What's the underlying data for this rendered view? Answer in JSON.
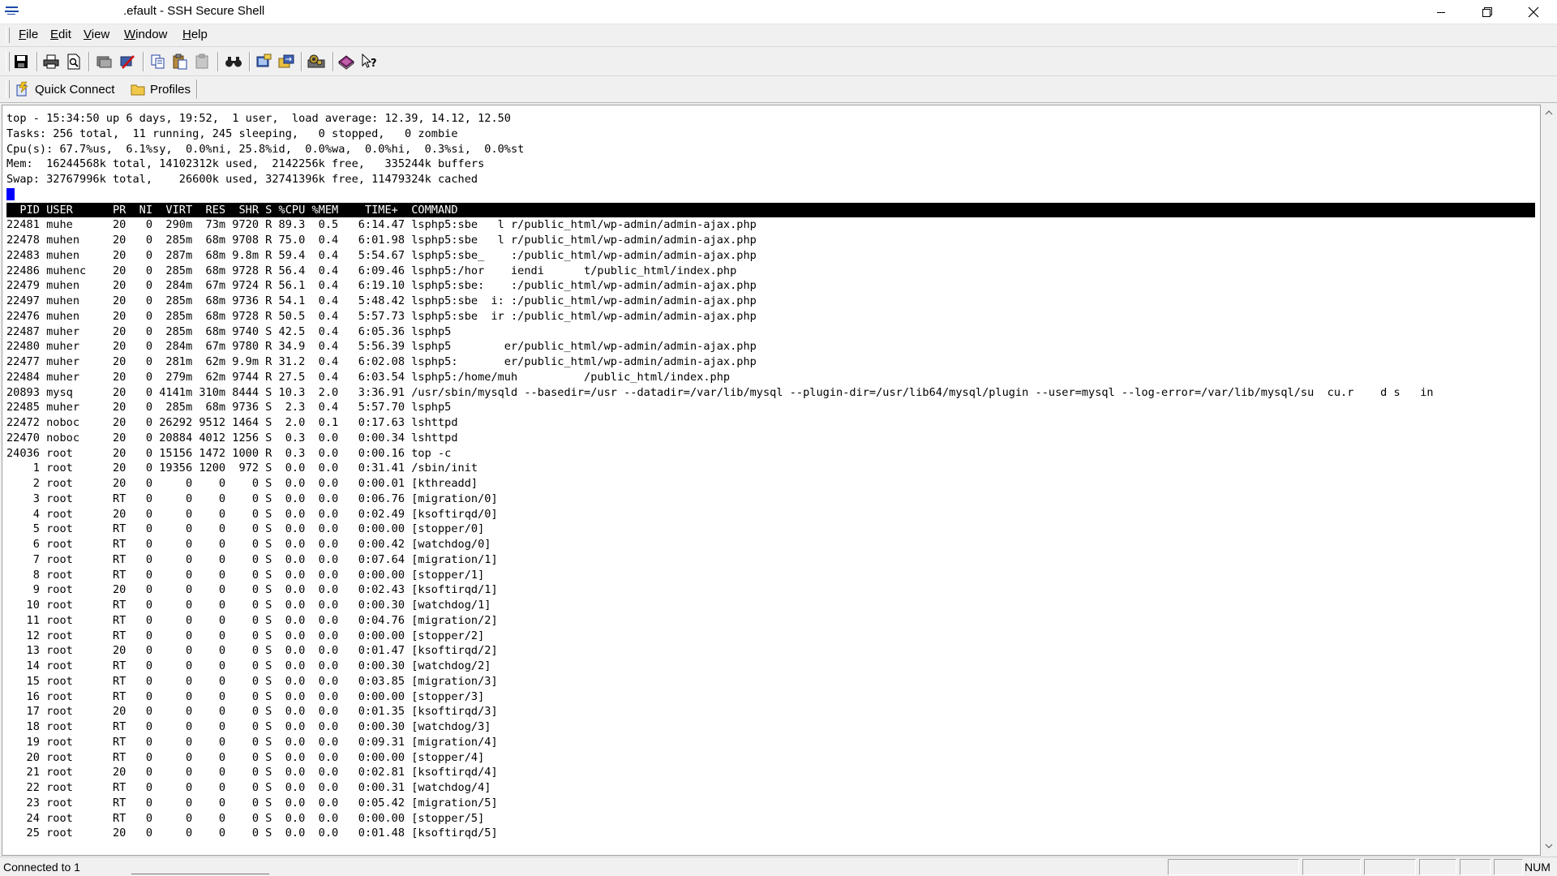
{
  "window": {
    "title": ".efault - SSH Secure Shell",
    "controls": [
      "minimize",
      "restore",
      "close"
    ]
  },
  "menu": {
    "items": [
      {
        "mnemonic": "F",
        "rest": "ile"
      },
      {
        "mnemonic": "E",
        "rest": "dit"
      },
      {
        "mnemonic": "V",
        "rest": "iew"
      },
      {
        "mnemonic": "W",
        "rest": "indow"
      },
      {
        "mnemonic": "H",
        "rest": "elp"
      }
    ]
  },
  "toolbar": {
    "icons": [
      "save-icon",
      "print-icon",
      "print-preview-icon",
      "new-file-transfer-icon",
      "disconnect-icon",
      "copy-icon",
      "paste-icon",
      "paste-disabled-icon",
      "find-icon",
      "new-terminal-icon",
      "file-transfer-icon",
      "settings-icon",
      "help-book-icon",
      "whats-this-icon"
    ]
  },
  "quickbar": {
    "quick_connect": "Quick Connect",
    "profiles": "Profiles"
  },
  "terminal": {
    "summary": [
      "top - 15:34:50 up 6 days, 19:52,  1 user,  load average: 12.39, 14.12, 12.50",
      "Tasks: 256 total,  11 running, 245 sleeping,   0 stopped,   0 zombie",
      "Cpu(s): 67.7%us,  6.1%sy,  0.0%ni, 25.8%id,  0.0%wa,  0.0%hi,  0.3%si,  0.0%st",
      "Mem:  16244568k total, 14102312k used,  2142256k free,   335244k buffers",
      "Swap: 32767996k total,    26600k used, 32741396k free, 11479324k cached"
    ],
    "header": "  PID USER      PR  NI  VIRT  RES  SHR S %CPU %MEM    TIME+  COMMAND",
    "processes": [
      "22481 muhe      20   0  290m  73m 9720 R 89.3  0.5   6:14.47 lsphp5:sbe   l r/public_html/wp-admin/admin-ajax.php",
      "22478 muhen     20   0  285m  68m 9708 R 75.0  0.4   6:01.98 lsphp5:sbe   l r/public_html/wp-admin/admin-ajax.php",
      "22483 muhen     20   0  287m  68m 9.8m R 59.4  0.4   5:54.67 lsphp5:sbe_    :/public_html/wp-admin/admin-ajax.php",
      "22486 muhenc    20   0  285m  68m 9728 R 56.4  0.4   6:09.46 lsphp5:/hor    iendi      t/public_html/index.php",
      "22479 muhen     20   0  284m  67m 9724 R 56.1  0.4   6:19.10 lsphp5:sbe:    :/public_html/wp-admin/admin-ajax.php",
      "22497 muhen     20   0  285m  68m 9736 R 54.1  0.4   5:48.42 lsphp5:sbe  i: :/public_html/wp-admin/admin-ajax.php",
      "22476 muhen     20   0  285m  68m 9728 R 50.5  0.4   5:57.73 lsphp5:sbe  ir :/public_html/wp-admin/admin-ajax.php",
      "22487 muher     20   0  285m  68m 9740 S 42.5  0.4   6:05.36 lsphp5",
      "22480 muher     20   0  284m  67m 9780 R 34.9  0.4   5:56.39 lsphp5        er/public_html/wp-admin/admin-ajax.php",
      "22477 muher     20   0  281m  62m 9.9m R 31.2  0.4   6:02.08 lsphp5:       er/public_html/wp-admin/admin-ajax.php",
      "22484 muher     20   0  279m  62m 9744 R 27.5  0.4   6:03.54 lsphp5:/home/muh          /public_html/index.php",
      "20893 mysq      20   0 4141m 310m 8444 S 10.3  2.0   3:36.91 /usr/sbin/mysqld --basedir=/usr --datadir=/var/lib/mysql --plugin-dir=/usr/lib64/mysql/plugin --user=mysql --log-error=/var/lib/mysql/su  cu.r    d s   in",
      "22485 muher     20   0  285m  68m 9736 S  2.3  0.4   5:57.70 lsphp5",
      "22472 noboc     20   0 26292 9512 1464 S  2.0  0.1   0:17.63 lshttpd",
      "22470 noboc     20   0 20884 4012 1256 S  0.3  0.0   0:00.34 lshttpd",
      "24036 root      20   0 15156 1472 1000 R  0.3  0.0   0:00.16 top -c",
      "    1 root      20   0 19356 1200  972 S  0.0  0.0   0:31.41 /sbin/init",
      "    2 root      20   0     0    0    0 S  0.0  0.0   0:00.01 [kthreadd]",
      "    3 root      RT   0     0    0    0 S  0.0  0.0   0:06.76 [migration/0]",
      "    4 root      20   0     0    0    0 S  0.0  0.0   0:02.49 [ksoftirqd/0]",
      "    5 root      RT   0     0    0    0 S  0.0  0.0   0:00.00 [stopper/0]",
      "    6 root      RT   0     0    0    0 S  0.0  0.0   0:00.42 [watchdog/0]",
      "    7 root      RT   0     0    0    0 S  0.0  0.0   0:07.64 [migration/1]",
      "    8 root      RT   0     0    0    0 S  0.0  0.0   0:00.00 [stopper/1]",
      "    9 root      20   0     0    0    0 S  0.0  0.0   0:02.43 [ksoftirqd/1]",
      "   10 root      RT   0     0    0    0 S  0.0  0.0   0:00.30 [watchdog/1]",
      "   11 root      RT   0     0    0    0 S  0.0  0.0   0:04.76 [migration/2]",
      "   12 root      RT   0     0    0    0 S  0.0  0.0   0:00.00 [stopper/2]",
      "   13 root      20   0     0    0    0 S  0.0  0.0   0:01.47 [ksoftirqd/2]",
      "   14 root      RT   0     0    0    0 S  0.0  0.0   0:00.30 [watchdog/2]",
      "   15 root      RT   0     0    0    0 S  0.0  0.0   0:03.85 [migration/3]",
      "   16 root      RT   0     0    0    0 S  0.0  0.0   0:00.00 [stopper/3]",
      "   17 root      20   0     0    0    0 S  0.0  0.0   0:01.35 [ksoftirqd/3]",
      "   18 root      RT   0     0    0    0 S  0.0  0.0   0:00.30 [watchdog/3]",
      "   19 root      RT   0     0    0    0 S  0.0  0.0   0:09.31 [migration/4]",
      "   20 root      RT   0     0    0    0 S  0.0  0.0   0:00.00 [stopper/4]",
      "   21 root      20   0     0    0    0 S  0.0  0.0   0:02.81 [ksoftirqd/4]",
      "   22 root      RT   0     0    0    0 S  0.0  0.0   0:00.31 [watchdog/4]",
      "   23 root      RT   0     0    0    0 S  0.0  0.0   0:05.42 [migration/5]",
      "   24 root      RT   0     0    0    0 S  0.0  0.0   0:00.00 [stopper/5]",
      "   25 root      20   0     0    0    0 S  0.0  0.0   0:01.48 [ksoftirqd/5]"
    ]
  },
  "status": {
    "connection": "Connected to 1",
    "num": "NUM"
  }
}
